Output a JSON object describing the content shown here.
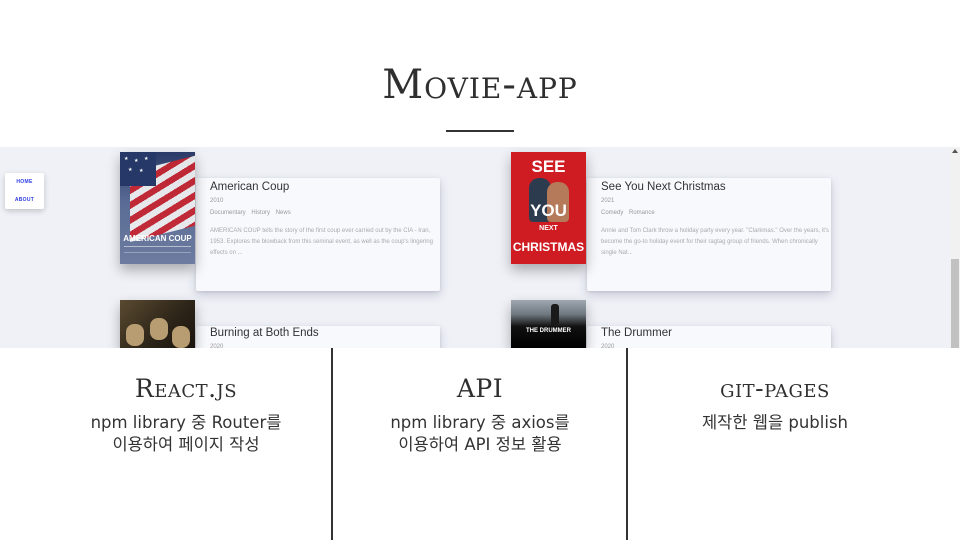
{
  "slide": {
    "title": "Movie-app"
  },
  "screenshot": {
    "nav": {
      "home_label": "HOME",
      "about_label": "ABOUT"
    },
    "movies": [
      {
        "title": "American Coup",
        "year": "2010",
        "genres": [
          "Documentary",
          "History",
          "News"
        ],
        "summary": "AMERICAN COUP tells the story of the first coup ever carried out by the CIA - Iran, 1953. Explores the blowback from this seminal event, as well as the coup's lingering effects on ...",
        "poster_text": "AMERICAN COUP"
      },
      {
        "title": "See You Next Christmas",
        "year": "2021",
        "genres": [
          "Comedy",
          "Romance"
        ],
        "summary": "Annie and Tom Clark throw a holiday party every year. \"Clarkmas.\" Over the years, it's become the go-to holiday event for their ragtag group of friends. When chronically single Nat...",
        "poster_text": [
          "SEE",
          "YOU",
          "NEXT",
          "CHRISTMAS"
        ]
      },
      {
        "title": "Burning at Both Ends",
        "year": "2020"
      },
      {
        "title": "The Drummer",
        "year": "2020",
        "poster_text": "THE DRUMMER"
      }
    ]
  },
  "columns": [
    {
      "title": "React.js",
      "lines": [
        "npm library 중 Router를",
        "이용하여 페이지 작성"
      ]
    },
    {
      "title": "API",
      "lines": [
        "npm library 중 axios를",
        "이용하여 API 정보 활용"
      ]
    },
    {
      "title": "git-pages",
      "lines": [
        "제작한 웹을 publish"
      ]
    }
  ],
  "colors": {
    "screenshot_bg": "#eff1f7",
    "nav_link": "#2c3ce3",
    "card_bg": "#f8f9fd",
    "christmas_red": "#cf1c22"
  }
}
